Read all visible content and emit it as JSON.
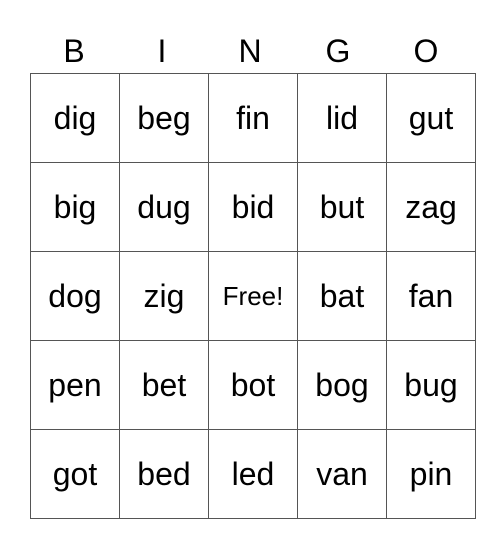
{
  "header": [
    "B",
    "I",
    "N",
    "G",
    "O"
  ],
  "rows": [
    [
      "dig",
      "beg",
      "fin",
      "lid",
      "gut"
    ],
    [
      "big",
      "dug",
      "bid",
      "but",
      "zag"
    ],
    [
      "dog",
      "zig",
      "Free!",
      "bat",
      "fan"
    ],
    [
      "pen",
      "bet",
      "bot",
      "bog",
      "bug"
    ],
    [
      "got",
      "bed",
      "led",
      "van",
      "pin"
    ]
  ]
}
